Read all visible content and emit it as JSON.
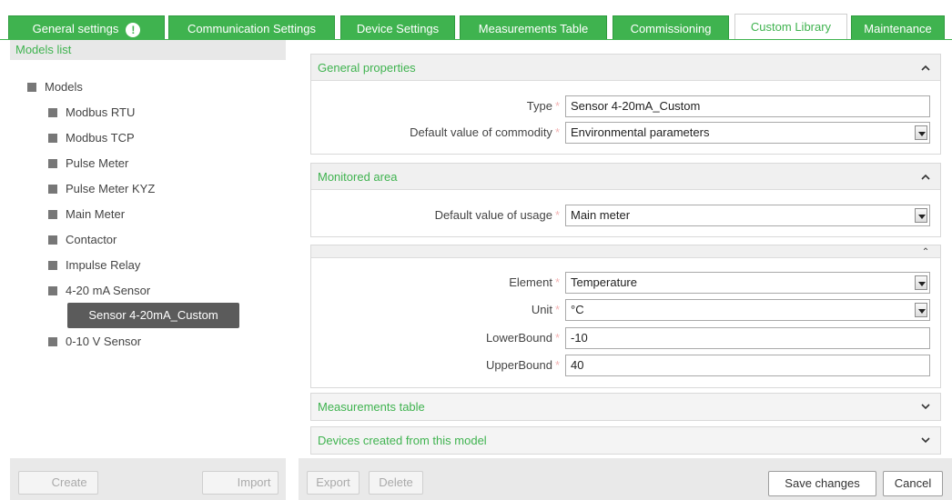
{
  "tabs": [
    {
      "label": "General settings",
      "warning": "!"
    },
    {
      "label": "Communication Settings"
    },
    {
      "label": "Device Settings"
    },
    {
      "label": "Measurements Table"
    },
    {
      "label": "Commissioning"
    },
    {
      "label": "Custom Library",
      "active": true
    },
    {
      "label": "Maintenance"
    }
  ],
  "models_panel": {
    "title": "Models list",
    "root": "Models",
    "items": [
      "Modbus RTU",
      "Modbus TCP",
      "Pulse Meter",
      "Pulse Meter KYZ",
      "Main Meter",
      "Contactor",
      "Impulse Relay",
      "4-20 mA Sensor"
    ],
    "selected_child": "Sensor 4-20mA_Custom",
    "after_items": [
      "0-10 V Sensor"
    ],
    "create_label": "Create",
    "import_label": "Import"
  },
  "general_properties": {
    "title": "General properties",
    "type_label": "Type",
    "type_value": "Sensor 4-20mA_Custom",
    "commodity_label": "Default value of commodity",
    "commodity_value": "Environmental parameters"
  },
  "monitored_area": {
    "title": "Monitored area",
    "usage_label": "Default value of usage",
    "usage_value": "Main meter"
  },
  "measurement": {
    "element_label": "Element",
    "element_value": "Temperature",
    "unit_label": "Unit",
    "unit_value": "°C",
    "lower_label": "LowerBound",
    "lower_value": "-10",
    "upper_label": "UpperBound",
    "upper_value": "40"
  },
  "collapsed_sections": {
    "measurements_table": "Measurements table",
    "devices_created": "Devices created from this model"
  },
  "required_mark": "*",
  "footer": {
    "export_label": "Export",
    "delete_label": "Delete",
    "save_label": "Save changes",
    "cancel_label": "Cancel"
  },
  "colors": {
    "accent": "#3fb34f",
    "selected_bg": "#5b5b5b"
  }
}
